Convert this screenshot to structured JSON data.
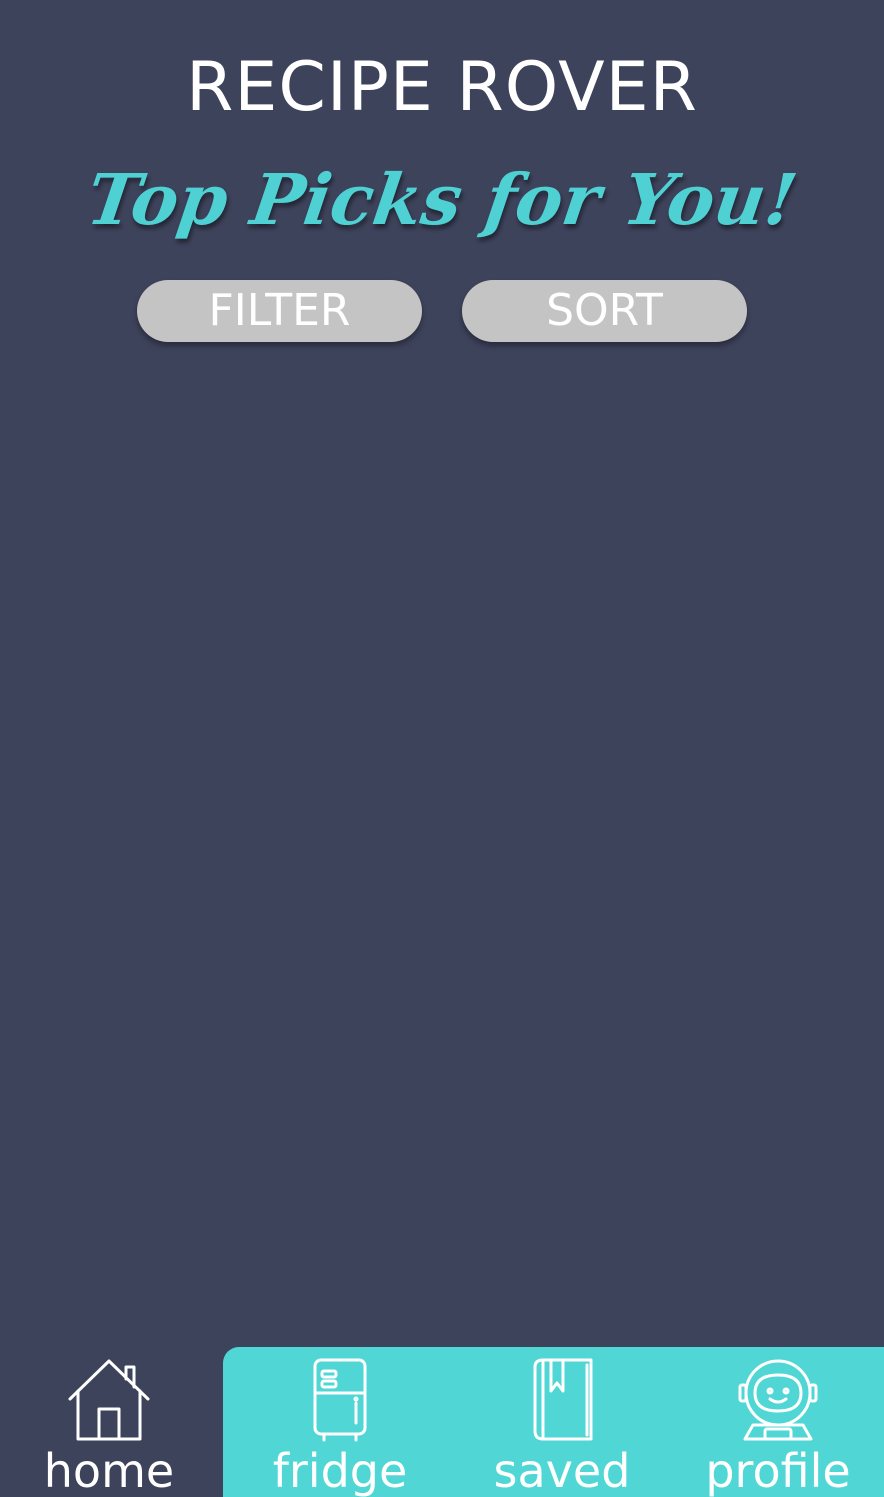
{
  "header": {
    "app_title": "RECIPE ROVER",
    "subtitle": "Top Picks for You!"
  },
  "controls": {
    "filter_label": "FILTER",
    "sort_label": "SORT"
  },
  "nav": {
    "active": "home",
    "items": [
      {
        "id": "home",
        "label": "home",
        "icon": "house-icon"
      },
      {
        "id": "fridge",
        "label": "fridge",
        "icon": "fridge-icon"
      },
      {
        "id": "saved",
        "label": "saved",
        "icon": "bookmark-book-icon"
      },
      {
        "id": "profile",
        "label": "profile",
        "icon": "astronaut-avatar-icon"
      }
    ]
  },
  "colors": {
    "background": "#3e435c",
    "accent": "#4fd1d3",
    "nav_panel": "#51d6d6",
    "pill": "#c4c4c4",
    "text": "#ffffff"
  }
}
